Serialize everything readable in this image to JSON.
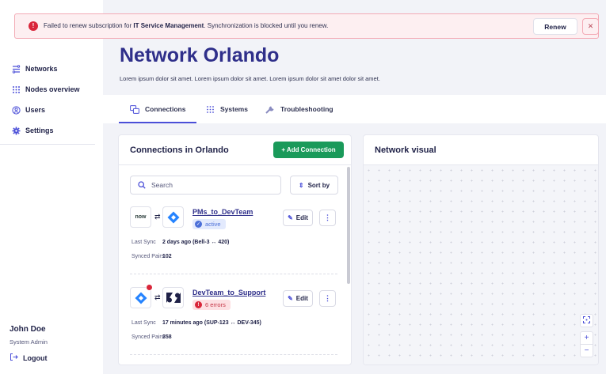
{
  "alert": {
    "text_before": "Failed to renew subscription for ",
    "subscription_name": "IT Service Management",
    "text_after": ". Synchronization is blocked until you renew.",
    "renew_label": "Renew",
    "close_label": "✕"
  },
  "sidebar": {
    "items": [
      {
        "label": "Networks",
        "icon": "network-icon"
      },
      {
        "label": "Nodes overview",
        "icon": "grid-icon"
      },
      {
        "label": "Users",
        "icon": "user-icon"
      },
      {
        "label": "Settings",
        "icon": "gear-icon"
      }
    ],
    "user_name": "John Doe",
    "user_role": "System Admin",
    "logout_label": "Logout"
  },
  "header": {
    "title": "Network Orlando",
    "description": "Lorem ipsum dolor sit amet. Lorem ipsum dolor sit amet. Lorem ipsum dolor sit amet dolor sit amet."
  },
  "tabs": [
    {
      "label": "Connections",
      "active": true
    },
    {
      "label": "Systems",
      "active": false
    },
    {
      "label": "Troubleshooting",
      "active": false
    }
  ],
  "connections_panel": {
    "title": "Connections in Orlando",
    "add_label": "+ Add Connection",
    "search_placeholder": "Search",
    "sort_label": "Sort by",
    "items": [
      {
        "name": "PMs_to_DevTeam",
        "source_logo": "now",
        "status": "active",
        "last_sync_key": "Last Sync",
        "last_sync_value": "2 days ago (Bell-3 ↔ 420)",
        "pairs_key": "Synced Pairs",
        "pairs_value": "102",
        "edit_label": "Edit",
        "more_label": "⋮"
      },
      {
        "name": "DevTeam_to_Support",
        "status": "6 errors",
        "last_sync_key": "Last Sync",
        "last_sync_value": "17 minutes ago (SUP-123 ↔ DEV-345)",
        "pairs_key": "Synced Pairs",
        "pairs_value": "358",
        "edit_label": "Edit",
        "more_label": "⋮"
      }
    ]
  },
  "visual_panel": {
    "title": "Network visual",
    "zoom_in": "+",
    "zoom_out": "−"
  },
  "colors": {
    "accent": "#4b4fd8",
    "title": "#2f2f8a",
    "success": "#1a9a5a",
    "error": "#d9263a"
  }
}
